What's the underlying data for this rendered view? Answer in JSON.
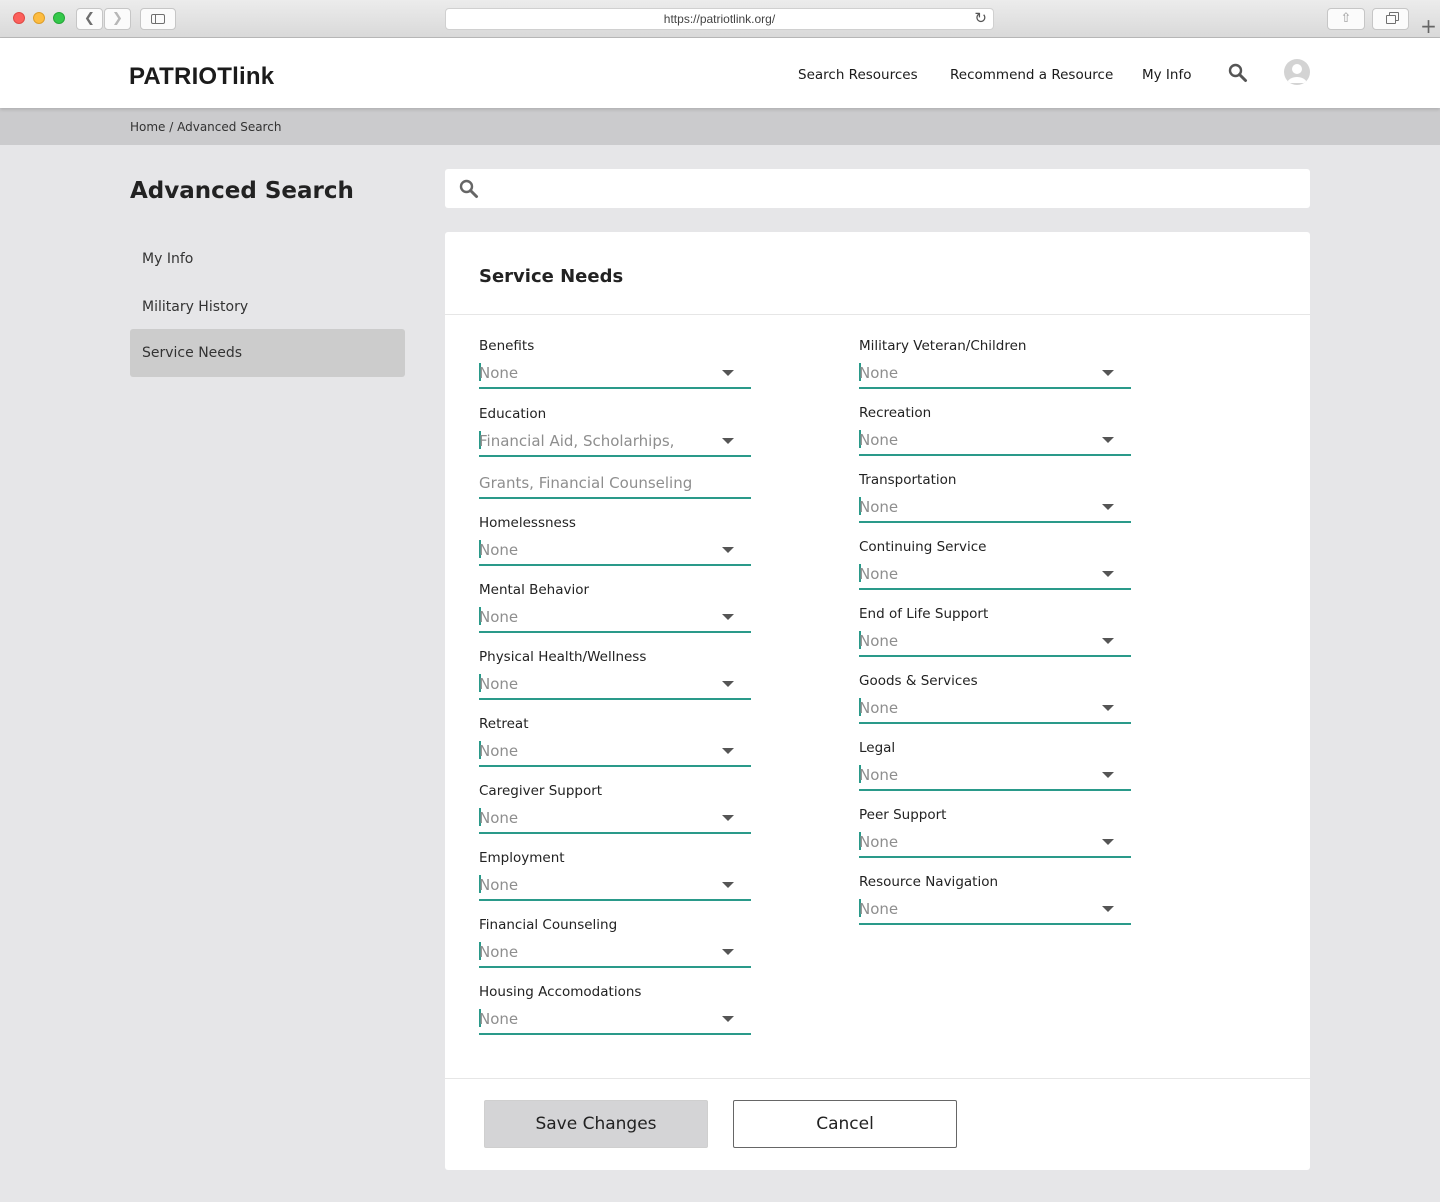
{
  "browser": {
    "url": "https://patriotlink.org/",
    "icons": [
      "back-arrow-icon",
      "forward-arrow-icon",
      "sidebar-icon",
      "reload-icon",
      "share-icon",
      "tabs-icon",
      "plus-icon"
    ]
  },
  "header": {
    "brand": "PATRIOTlink",
    "nav": [
      "Search Resources",
      "Recommend a Resource",
      "My Info"
    ],
    "icons": [
      "search-icon",
      "user-avatar-icon"
    ]
  },
  "breadcrumb": "Home / Advanced Search",
  "page_title": "Advanced Search",
  "sidebar": {
    "items": [
      {
        "label": "My Info",
        "active": false
      },
      {
        "label": "Military History",
        "active": false
      },
      {
        "label": "Service Needs",
        "active": true
      }
    ]
  },
  "search": {
    "placeholder": ""
  },
  "card": {
    "title": "Service Needs",
    "left_fields": [
      {
        "label": "Benefits",
        "value": "None"
      },
      {
        "label": "Education",
        "value": "Financial Aid, Scholarhips,",
        "value_cont": "Grants, Financial Counseling"
      },
      {
        "label": "Homelessness",
        "value": "None"
      },
      {
        "label": "Mental Behavior",
        "value": "None"
      },
      {
        "label": "Physical Health/Wellness",
        "value": "None"
      },
      {
        "label": "Retreat",
        "value": "None"
      },
      {
        "label": "Caregiver Support",
        "value": "None"
      },
      {
        "label": "Employment",
        "value": "None"
      },
      {
        "label": "Financial Counseling",
        "value": "None"
      },
      {
        "label": "Housing Accomodations",
        "value": "None"
      }
    ],
    "right_fields": [
      {
        "label": "Military Veteran/Children",
        "value": "None"
      },
      {
        "label": "Recreation",
        "value": "None"
      },
      {
        "label": "Transportation",
        "value": "None"
      },
      {
        "label": "Continuing Service",
        "value": "None"
      },
      {
        "label": "End of Life Support",
        "value": "None"
      },
      {
        "label": "Goods & Services",
        "value": "None"
      },
      {
        "label": "Legal",
        "value": "None"
      },
      {
        "label": "Peer Support",
        "value": "None"
      },
      {
        "label": "Resource Navigation",
        "value": "None"
      }
    ],
    "save_label": "Save Changes",
    "cancel_label": "Cancel"
  },
  "colors": {
    "accent": "#2a9a8a",
    "background": "#e6e6e8",
    "active_item": "#cccccc"
  }
}
